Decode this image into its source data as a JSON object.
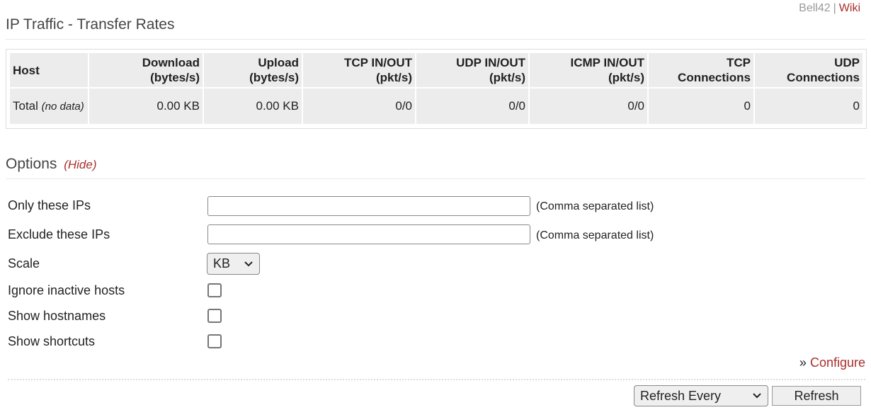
{
  "header": {
    "router_name": "Bell42",
    "separator": "|",
    "wiki_link": "Wiki",
    "title": "IP Traffic - Transfer Rates"
  },
  "table": {
    "columns": [
      {
        "line1": "Host",
        "line2": ""
      },
      {
        "line1": "Download",
        "line2": "(bytes/s)"
      },
      {
        "line1": "Upload",
        "line2": "(bytes/s)"
      },
      {
        "line1": "TCP IN/OUT",
        "line2": "(pkt/s)"
      },
      {
        "line1": "UDP IN/OUT",
        "line2": "(pkt/s)"
      },
      {
        "line1": "ICMP IN/OUT",
        "line2": "(pkt/s)"
      },
      {
        "line1": "TCP",
        "line2": "Connections"
      },
      {
        "line1": "UDP",
        "line2": "Connections"
      }
    ],
    "total_row": {
      "host": "Total",
      "note": "(no data)",
      "download": "0.00 KB",
      "upload": "0.00 KB",
      "tcp_inout": "0/0",
      "udp_inout": "0/0",
      "icmp_inout": "0/0",
      "tcp_connections": "0",
      "udp_connections": "0"
    }
  },
  "options": {
    "heading": "Options",
    "hide_link": "(Hide)",
    "only_ips": {
      "label": "Only these IPs",
      "value": "",
      "hint": "(Comma separated list)"
    },
    "exclude_ips": {
      "label": "Exclude these IPs",
      "value": "",
      "hint": "(Comma separated list)"
    },
    "scale": {
      "label": "Scale",
      "selected": "KB"
    },
    "ignore_inactive": {
      "label": "Ignore inactive hosts",
      "checked": false
    },
    "show_hostnames": {
      "label": "Show hostnames",
      "checked": false
    },
    "show_shortcuts": {
      "label": "Show shortcuts",
      "checked": false
    }
  },
  "footer": {
    "configure_prefix": "»",
    "configure_link": "Configure",
    "refresh_select": "Refresh Every",
    "refresh_button": "Refresh"
  },
  "colors": {
    "link": "#a8302c",
    "table_cell_bg": "#ececec"
  },
  "icons": {
    "dropdown": "chevron-down-icon"
  }
}
